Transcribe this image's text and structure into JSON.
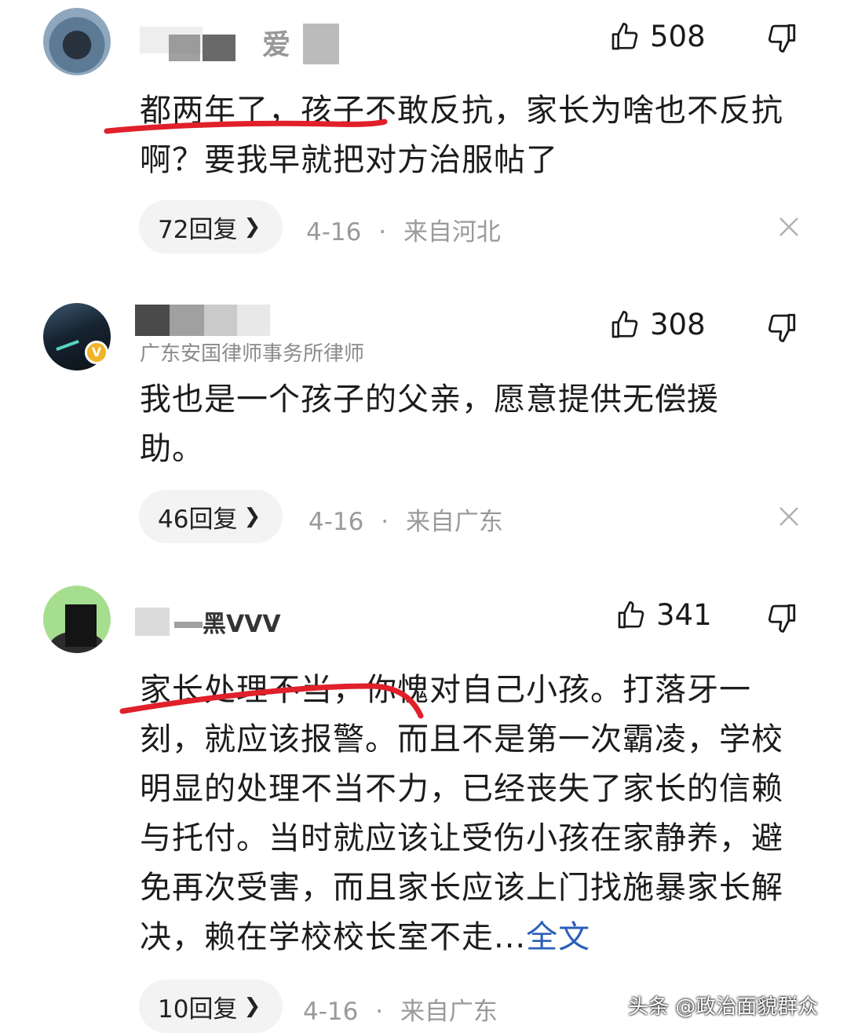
{
  "comments": [
    {
      "user_fragment": "爱",
      "user_title": "",
      "likes": "508",
      "text_before": "都两年了，孩子不敢反抗，家长为啥也不反抗啊？要我早就把对方治服帖了",
      "text_link": "",
      "replies": "72回复",
      "date": "4-16",
      "separator": "·",
      "location": "来自河北"
    },
    {
      "user_fragment": "",
      "user_title": "广东安国律师事务所律师",
      "verified_badge": "V",
      "likes": "308",
      "text_before": "我也是一个孩子的父亲，愿意提供无偿援助。",
      "text_link": "",
      "replies": "46回复",
      "date": "4-16",
      "separator": "·",
      "location": "来自广东"
    },
    {
      "user_fragment": "黑VVV",
      "user_title": "",
      "likes": "341",
      "text_before": "家长处理不当，你愧对自己小孩。打落牙一刻，就应该报警。而且不是第一次霸凌，学校明显的处理不当不力，已经丧失了家长的信赖与托付。当时就应该让受伤小孩在家静养，避免再次受害，而且家长应该上门找施暴家长解决，赖在学校校长室不走...",
      "text_link": "全文",
      "replies": "10回复",
      "date": "4-16",
      "separator": "·",
      "location": "来自广东"
    }
  ],
  "watermark": "头条 @政治面貌群众",
  "colors": {
    "accent_link": "#2c5fb8",
    "annotation_red": "#e0202a"
  },
  "icons": [
    "thumbs-up-icon",
    "thumbs-down-icon",
    "chevron-right-icon",
    "close-icon",
    "verified-icon"
  ]
}
